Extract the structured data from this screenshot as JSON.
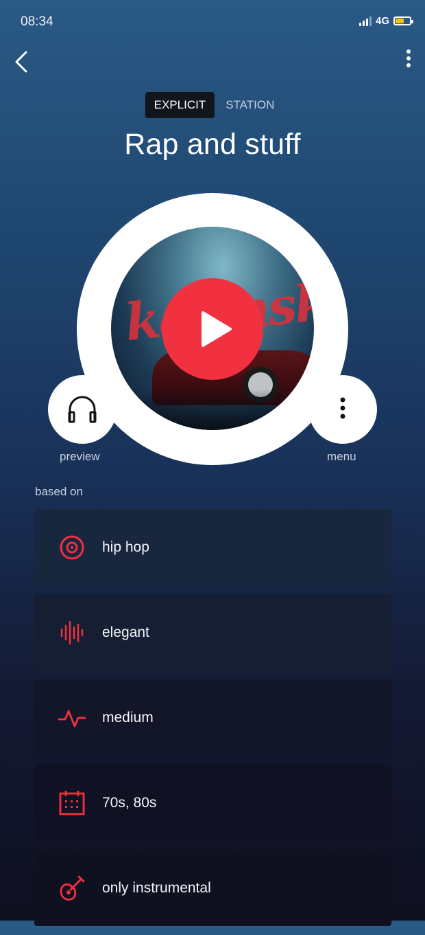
{
  "status": {
    "time": "08:34",
    "network": "4G"
  },
  "header": {
    "tag_explicit": "EXPLICIT",
    "tag_station": "STATION",
    "title": "Rap and stuff"
  },
  "player": {
    "preview_label": "preview",
    "menu_label": "menu",
    "cover_text": "kavinsky"
  },
  "based_on": {
    "label": "based on",
    "items": [
      {
        "label": "hip hop",
        "icon": "vinyl-icon"
      },
      {
        "label": "elegant",
        "icon": "waveform-icon"
      },
      {
        "label": "medium",
        "icon": "pulse-icon"
      },
      {
        "label": "70s, 80s",
        "icon": "calendar-icon"
      },
      {
        "label": "only instrumental",
        "icon": "guitar-icon"
      }
    ]
  },
  "colors": {
    "accent": "#f1313f",
    "card_top": "#1a2942",
    "card_bottom": "#0e1122"
  }
}
